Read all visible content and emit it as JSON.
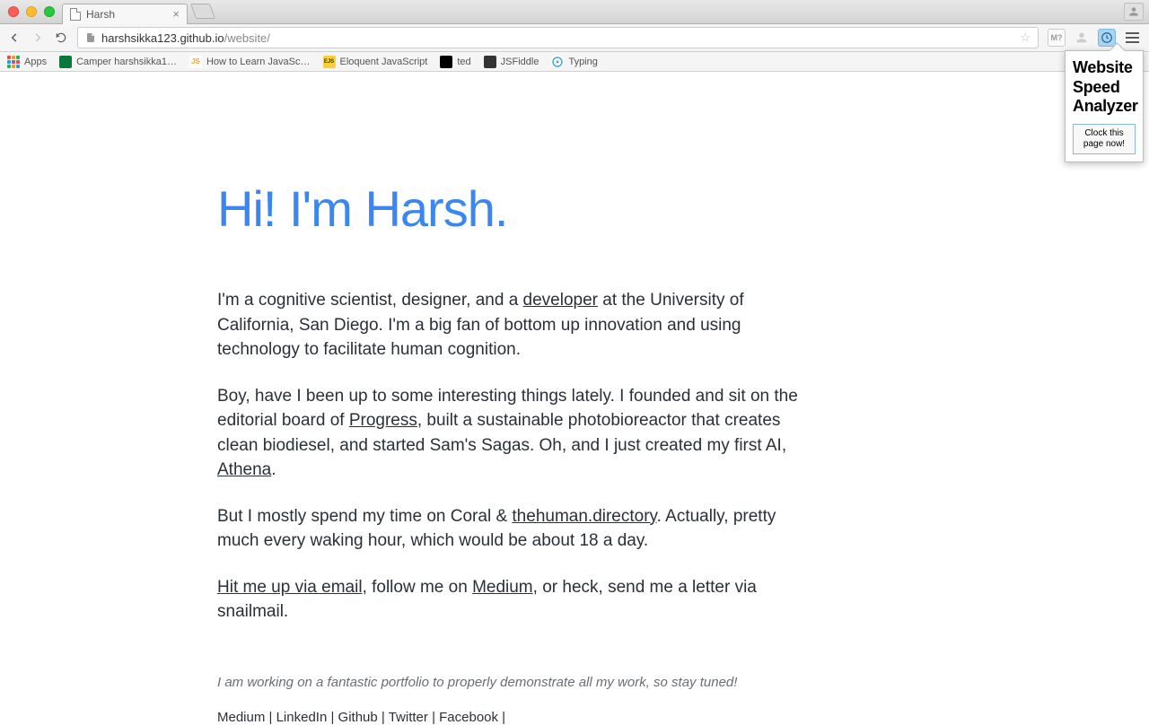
{
  "browser": {
    "tab_title": "Harsh",
    "url_host": "harshsikka123.github.io",
    "url_path": "/website/"
  },
  "bookmarks": [
    {
      "label": "Apps",
      "icon": "apps"
    },
    {
      "label": "Camper harshsikka1…",
      "icon": "camper",
      "bg": "#0a7a3a"
    },
    {
      "label": "How to Learn JavaSc…",
      "icon": "js",
      "bg": "#f0a030",
      "text": "JS"
    },
    {
      "label": "Eloquent JavaScript",
      "icon": "ejs",
      "bg": "#f7d038",
      "text": "EJS"
    },
    {
      "label": "ted",
      "icon": "ted",
      "bg": "#000",
      "text": ""
    },
    {
      "label": "JSFiddle",
      "icon": "jsf",
      "bg": "#333",
      "text": ""
    },
    {
      "label": "Typing",
      "icon": "typing",
      "bg": "#4aa8d8",
      "text": ""
    }
  ],
  "popup": {
    "title": "Website Speed Analyzer",
    "button": "Clock this page now!"
  },
  "content": {
    "headline": "Hi! I'm Harsh.",
    "p1_a": "I'm a cognitive scientist, designer, and a ",
    "p1_link1": "developer",
    "p1_b": " at the University of California, San Diego. I'm a big fan of bottom up innovation and using technology to facilitate human cognition.",
    "p2_a": "Boy, have I been up to some interesting things lately. I founded and sit on the editorial board of ",
    "p2_link1": "Progress",
    "p2_b": ", built a sustainable photobioreactor that creates clean biodiesel, and started Sam's Sagas. Oh, and I just created my first AI, ",
    "p2_link2": "Athena",
    "p2_c": ".",
    "p3_a": "But I mostly spend my time on Coral & ",
    "p3_link1": "thehuman.directory",
    "p3_b": ". Actually, pretty much every waking hour, which would be about 18 a day.",
    "p4_link1": "Hit me up via email",
    "p4_a": ", follow me on ",
    "p4_link2": "Medium",
    "p4_b": ", or heck, send me a letter via snailmail.",
    "note": "I am working on a fantastic portfolio to properly demonstrate all my work, so stay tuned!",
    "footer": {
      "medium": "Medium",
      "linkedin": "LinkedIn",
      "github": "Github",
      "twitter": "Twitter",
      "facebook": "Facebook",
      "sep": " | "
    }
  },
  "ext": {
    "m7": "M?"
  }
}
